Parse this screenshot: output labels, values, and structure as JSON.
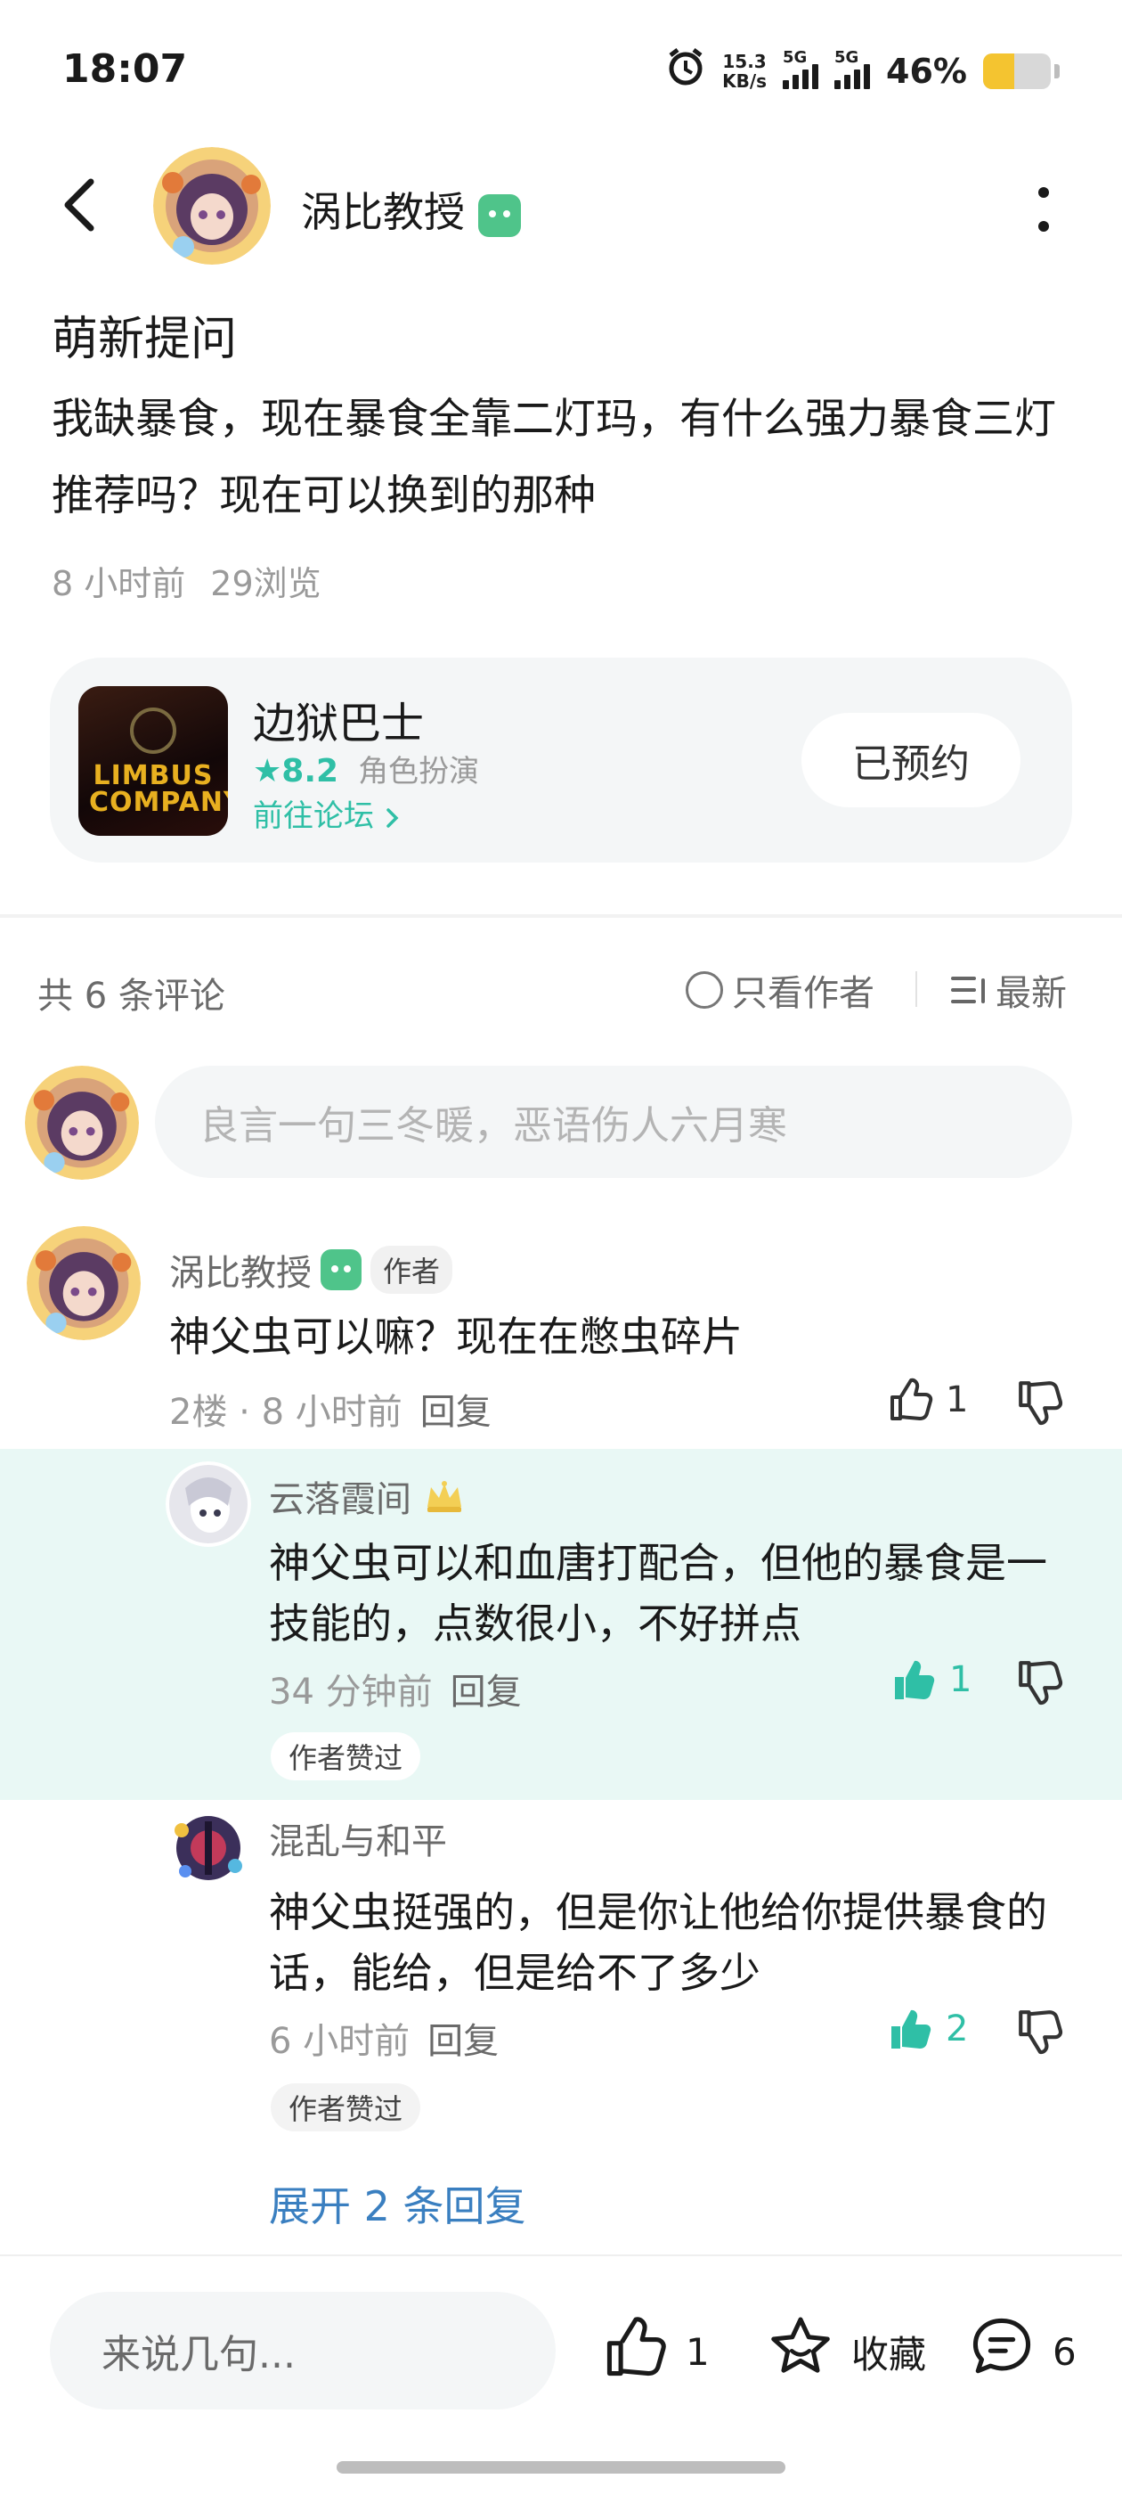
{
  "status_bar": {
    "time": "18:07",
    "net_speed_value": "15.3",
    "net_speed_unit": "KB/s",
    "sim1_label": "5G",
    "sim2_label": "5G",
    "battery_text": "46%",
    "battery_level": 0.46,
    "battery_color": "#f4c430"
  },
  "header": {
    "author_name": "涡比教授",
    "author_badge_icon": "game-badge-icon",
    "badge_color": "#4fc48a"
  },
  "post": {
    "title": "萌新提问",
    "body": "我缺暴食，现在暴食全靠二灯玛，有什么强力暴食三灯推荐吗？现在可以换到的那种",
    "time_ago": "8 小时前",
    "views": "29浏览"
  },
  "game_card": {
    "icon_text": "LIMBUS COMPANY",
    "name": "边狱巴士",
    "rating": "8.2",
    "genre": "角色扮演",
    "forum_link": "前往论坛",
    "reserve_label": "已预约",
    "accent_color": "#2fbfa6"
  },
  "comments_header": {
    "count_text": "共 6 条评论",
    "only_author": "只看作者",
    "sort": "最新"
  },
  "comment_input": {
    "placeholder": "良言一句三冬暖，恶语伤人六月寒"
  },
  "comment": {
    "name": "涡比教授",
    "author_tag": "作者",
    "text": "神父虫可以嘛？现在在憋虫碎片",
    "floor": "2楼",
    "time": "8 小时前",
    "reply_label": "回复",
    "likes": "1"
  },
  "replies": [
    {
      "name": "云落霞间",
      "text": "神父虫可以和血唐打配合，但他的暴食是一技能的，点数很小，不好拼点",
      "time": "34 分钟前",
      "reply_label": "回复",
      "likes": "1",
      "liked_tag": "作者赞过"
    },
    {
      "name": "混乱与和平",
      "text": "神父虫挺强的，但是你让他给你提供暴食的话，能给，但是给不了多少",
      "time": "6 小时前",
      "reply_label": "回复",
      "likes": "2",
      "liked_tag": "作者赞过"
    }
  ],
  "expand_replies": "展开 2 条回复",
  "bottom_bar": {
    "placeholder": "来说几句...",
    "likes": "1",
    "favorite_label": "收藏",
    "comments": "6"
  },
  "colors": {
    "highlight_bg": "#e9f8f5",
    "link_blue": "#3a7fc0",
    "teal": "#2fbfa6"
  }
}
